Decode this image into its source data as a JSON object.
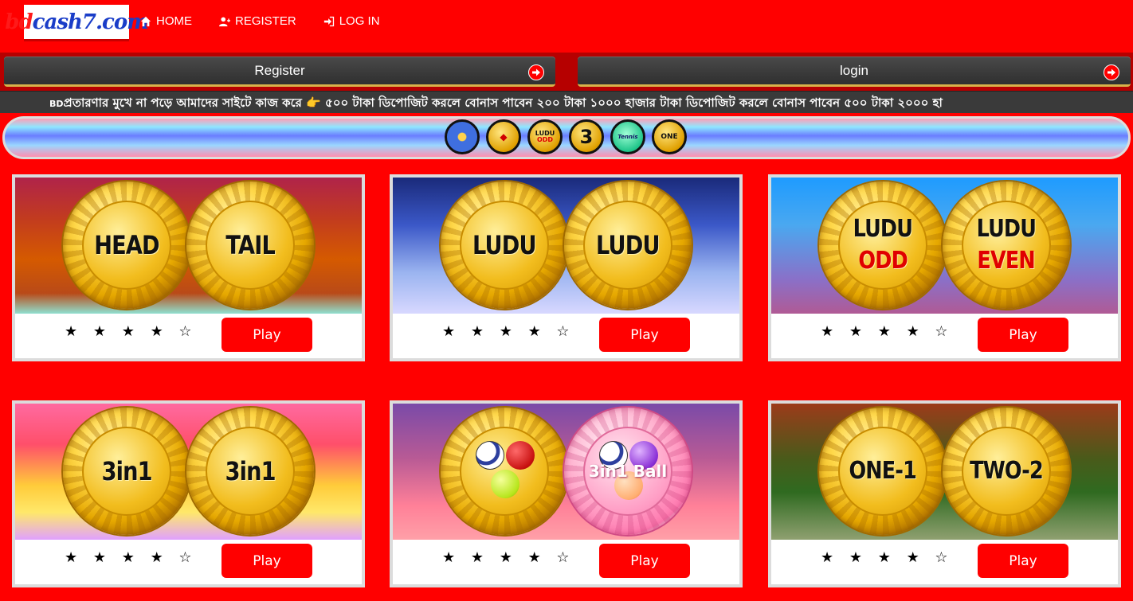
{
  "brand": {
    "logo_part1": "bd",
    "logo_part2": "cash7.com"
  },
  "nav": {
    "items": [
      {
        "label": "HOME",
        "icon": "home-icon"
      },
      {
        "label": "REGISTER",
        "icon": "user-plus-icon"
      },
      {
        "label": "LOG IN",
        "icon": "sign-in-icon"
      }
    ]
  },
  "auth": {
    "register_label": "Register",
    "login_label": "login"
  },
  "ticker": {
    "prefix": "BD",
    "text": "প্রতারণার মুখে না পড়ে আমাদের সাইটে কাজ করে 👉 ৫০০ টাকা ডিপোজিট করলে বোনাস পাবেন ২০০ টাকা ১০০০ হাজার টাকা ডিপোজিট করলে বোনাস পাবেন ৫০০ টাকা ২০০০ হা"
  },
  "game_icons": {
    "icon3_line1": "LUDU",
    "icon3_line2": "ODD",
    "icon4": "3",
    "icon5": "Tennis",
    "icon6": "ONE"
  },
  "games": [
    {
      "left": "HEAD",
      "right": "TAIL",
      "rating": 4,
      "play": "Play"
    },
    {
      "left": "LUDU",
      "right": "LUDU",
      "rating": 4,
      "play": "Play"
    },
    {
      "left_top": "LUDU",
      "left_bottom": "ODD",
      "right_top": "LUDU",
      "right_bottom": "EVEN",
      "rating": 4,
      "play": "Play"
    },
    {
      "left": "3in1",
      "right": "3in1",
      "rating": 4,
      "play": "Play"
    },
    {
      "right": "3in1 Ball",
      "rating": 4,
      "play": "Play"
    },
    {
      "left": "ONE-1",
      "right": "TWO-2",
      "rating": 4,
      "play": "Play"
    }
  ],
  "stars_text": "★ ★ ★ ★ ☆",
  "colors": {
    "page_bg": "#ff0000",
    "play_button": "#ff0000",
    "auth_button": "#3a3a3a",
    "accent_border": "#d8b24a"
  }
}
